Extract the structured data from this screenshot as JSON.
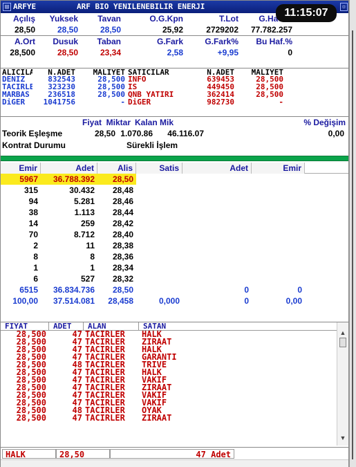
{
  "window": {
    "symbol": "ARFYE",
    "title": "ARF BIO YENILENEBILIR ENERJI",
    "clock": "11:15:07"
  },
  "stats": {
    "row1_headers": [
      "Açılış",
      "Yuksek",
      "Tavan",
      "O.G.Kpn",
      "T.Lot",
      "G.Hacim"
    ],
    "row1_values": [
      "28,50",
      "28,50",
      "28,50",
      "25,92",
      "2729202",
      "77.782.257"
    ],
    "row2_headers": [
      "A.Ort",
      "Dusuk",
      "Taban",
      "G.Fark",
      "G.Fark%",
      "Bu Haf.%"
    ],
    "row2_values": [
      "28,500",
      "28,50",
      "23,34",
      "2,58",
      "+9,95",
      "0"
    ]
  },
  "brokers": {
    "headers": [
      "ALICILA",
      "N.ADET",
      "MALIYET",
      "SATICILAR",
      "N.ADET",
      "MALIYET"
    ],
    "rows": [
      [
        "DENIZ",
        "832543",
        "28,500",
        "INFO",
        "639453",
        "28,500"
      ],
      [
        "TACIRLE",
        "323230",
        "28,500",
        "IS",
        "449450",
        "28,500"
      ],
      [
        "MARBAS",
        "236518",
        "28,500",
        "QNB YATIRI",
        "362414",
        "28,500"
      ],
      [
        "DiGER",
        "1041756",
        "-",
        "DiGER",
        "982730",
        "-"
      ]
    ]
  },
  "theoretical": {
    "headers": [
      "Fiyat",
      "Miktar",
      "Kalan Mik",
      "% Değişim"
    ],
    "label": "Teorik Eşleşme",
    "values": [
      "28,50",
      "1.070.86",
      "46.116.07",
      "0,00"
    ],
    "contract_label": "Kontrat Durumu",
    "contract_value": "Sürekli İşlem"
  },
  "depth": {
    "headers": [
      "Emir",
      "Adet",
      "Alis",
      "Satis",
      "Adet",
      "Emir"
    ],
    "rows": [
      [
        "5967",
        "36.788.392",
        "28,50",
        "",
        "",
        ""
      ],
      [
        "315",
        "30.432",
        "28,48",
        "",
        "",
        ""
      ],
      [
        "94",
        "5.281",
        "28,46",
        "",
        "",
        ""
      ],
      [
        "38",
        "1.113",
        "28,44",
        "",
        "",
        ""
      ],
      [
        "14",
        "259",
        "28,42",
        "",
        "",
        ""
      ],
      [
        "70",
        "8.712",
        "28,40",
        "",
        "",
        ""
      ],
      [
        "2",
        "11",
        "28,38",
        "",
        "",
        ""
      ],
      [
        "8",
        "8",
        "28,36",
        "",
        "",
        ""
      ],
      [
        "1",
        "1",
        "28,34",
        "",
        "",
        ""
      ],
      [
        "6",
        "527",
        "28,32",
        "",
        "",
        ""
      ]
    ],
    "total": [
      "6515",
      "36.834.736",
      "28,50",
      "",
      "0",
      "0"
    ],
    "average": [
      "100,00",
      "37.514.081",
      "28,458",
      "0,000",
      "0",
      "0,00"
    ]
  },
  "trades": {
    "headers": [
      "FIYAT",
      "ADET",
      "ALAN",
      "SATAN"
    ],
    "rows": [
      [
        "28,500",
        "47",
        "TACIRLER",
        "HALK"
      ],
      [
        "28,500",
        "47",
        "TACIRLER",
        "ZIRAAT"
      ],
      [
        "28,500",
        "47",
        "TACIRLER",
        "HALK"
      ],
      [
        "28,500",
        "47",
        "TACIRLER",
        "GARANTI"
      ],
      [
        "28,500",
        "48",
        "TACIRLER",
        "TRIVE"
      ],
      [
        "28,500",
        "47",
        "TACIRLER",
        "HALK"
      ],
      [
        "28,500",
        "47",
        "TACIRLER",
        "VAKIF"
      ],
      [
        "28,500",
        "47",
        "TACIRLER",
        "ZIRAAT"
      ],
      [
        "28,500",
        "47",
        "TACIRLER",
        "VAKIF"
      ],
      [
        "28,500",
        "47",
        "TACIRLER",
        "VAKIF"
      ],
      [
        "28,500",
        "48",
        "TACIRLER",
        "OYAK"
      ],
      [
        "28,500",
        "47",
        "TACIRLER",
        "ZIRAAT"
      ]
    ]
  },
  "status": {
    "broker": "HALK",
    "price": "28,50",
    "qty": "47 Adet"
  },
  "colors": {
    "title_bg": "#0b1f7a",
    "highlight": "#fbea1e",
    "green_bar": "#0aa44a",
    "red": "#c00000",
    "blue": "#1a3cd0"
  }
}
